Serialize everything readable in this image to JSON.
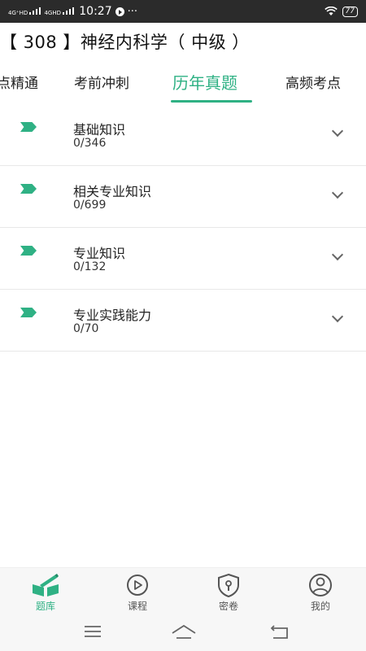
{
  "status_bar": {
    "signal1": "4G⁺HD",
    "signal2": "4GHD",
    "time": "10:27",
    "more": "···",
    "battery": "77"
  },
  "header": {
    "title": "【 308 】神经内科学（ 中级 ）"
  },
  "tabs": [
    {
      "label": "点精通",
      "active": false
    },
    {
      "label": "考前冲刺",
      "active": false
    },
    {
      "label": "历年真题",
      "active": true
    },
    {
      "label": "高频考点",
      "active": false
    }
  ],
  "list": [
    {
      "title": "基础知识",
      "count": "0/346"
    },
    {
      "title": "相关专业知识",
      "count": "0/699"
    },
    {
      "title": "专业知识",
      "count": "0/132"
    },
    {
      "title": "专业实践能力",
      "count": "0/70"
    }
  ],
  "bottom_nav": [
    {
      "label": "题库",
      "icon": "book-pen-icon",
      "active": true
    },
    {
      "label": "课程",
      "icon": "play-circle-icon",
      "active": false
    },
    {
      "label": "密卷",
      "icon": "lock-shield-icon",
      "active": false
    },
    {
      "label": "我的",
      "icon": "user-icon",
      "active": false
    }
  ],
  "colors": {
    "accent": "#2fb184",
    "status_bar": "#2b2b2b"
  }
}
